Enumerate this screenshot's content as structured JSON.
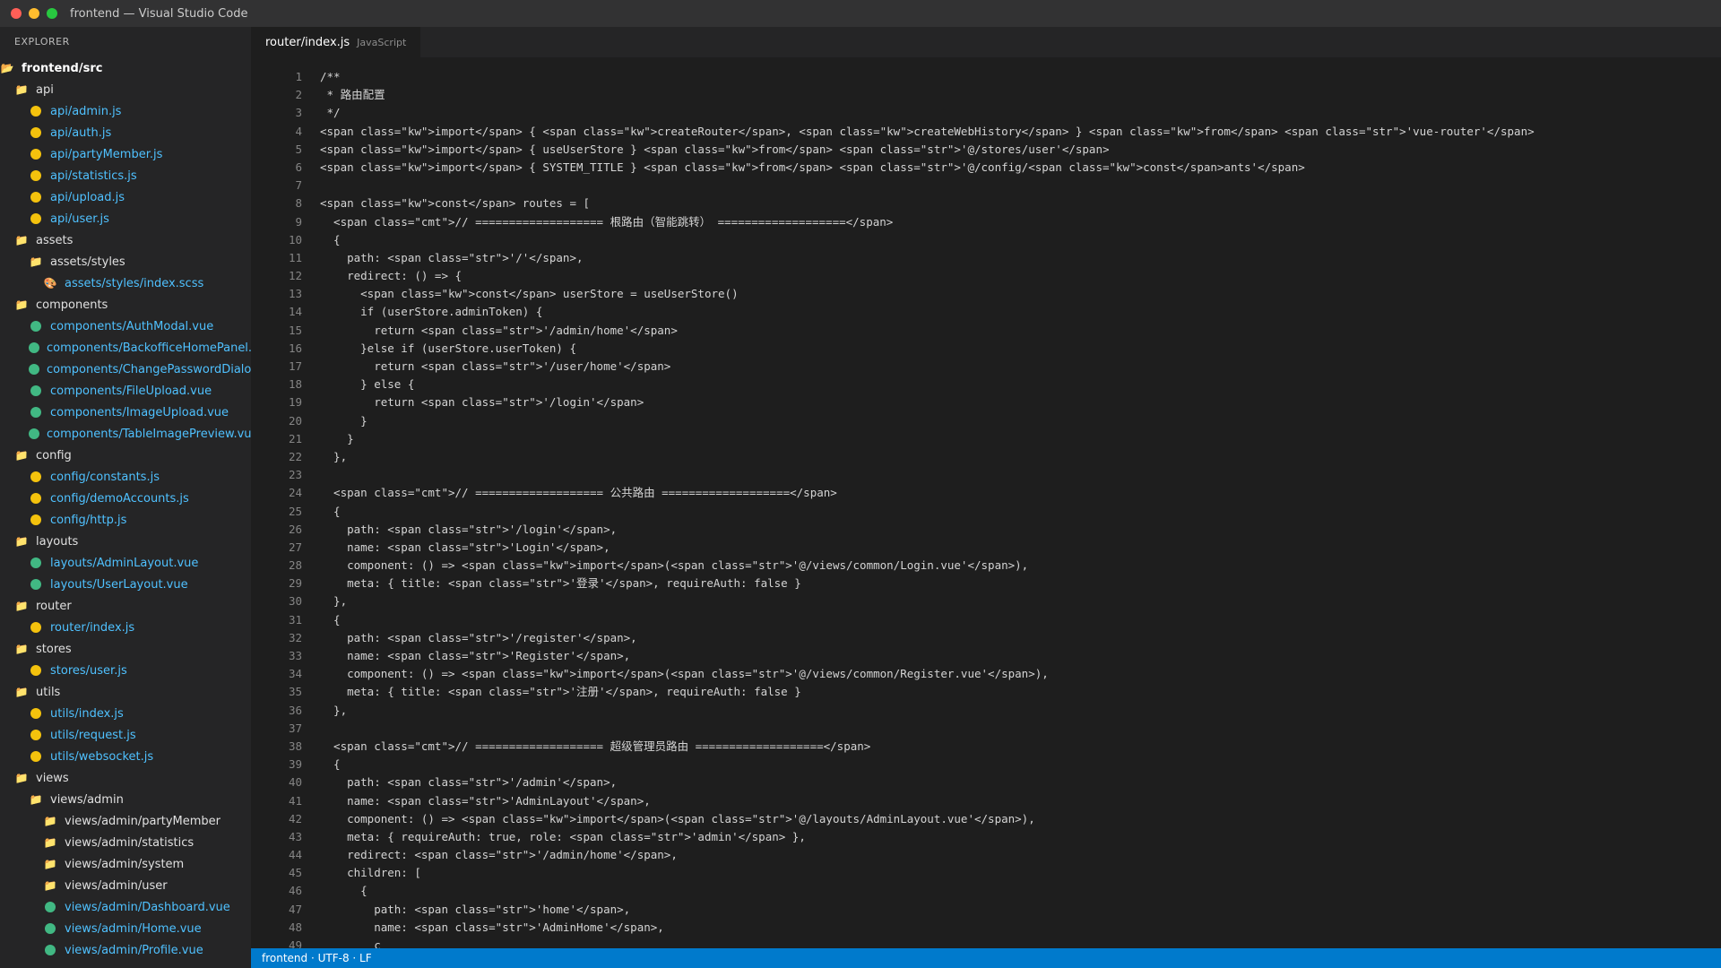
{
  "window": {
    "title": "frontend — Visual Studio Code"
  },
  "sidebar": {
    "header": "EXPLORER",
    "tree": [
      {
        "label": "frontend/src",
        "type": "root",
        "depth": 0
      },
      {
        "label": "api",
        "type": "folder",
        "depth": 1
      },
      {
        "label": "api/admin.js",
        "type": "js",
        "depth": 2
      },
      {
        "label": "api/auth.js",
        "type": "js",
        "depth": 2
      },
      {
        "label": "api/partyMember.js",
        "type": "js",
        "depth": 2
      },
      {
        "label": "api/statistics.js",
        "type": "js",
        "depth": 2
      },
      {
        "label": "api/upload.js",
        "type": "js",
        "depth": 2
      },
      {
        "label": "api/user.js",
        "type": "js",
        "depth": 2
      },
      {
        "label": "assets",
        "type": "folder",
        "depth": 1
      },
      {
        "label": "assets/styles",
        "type": "folder",
        "depth": 2
      },
      {
        "label": "assets/styles/index.scss",
        "type": "scss",
        "depth": 3
      },
      {
        "label": "components",
        "type": "folder",
        "depth": 1
      },
      {
        "label": "components/AuthModal.vue",
        "type": "vue",
        "depth": 2
      },
      {
        "label": "components/BackofficeHomePanel.v",
        "type": "vue",
        "depth": 2
      },
      {
        "label": "components/ChangePasswordDialog",
        "type": "vue",
        "depth": 2
      },
      {
        "label": "components/FileUpload.vue",
        "type": "vue",
        "depth": 2
      },
      {
        "label": "components/ImageUpload.vue",
        "type": "vue",
        "depth": 2
      },
      {
        "label": "components/TableImagePreview.vue",
        "type": "vue",
        "depth": 2
      },
      {
        "label": "config",
        "type": "folder",
        "depth": 1
      },
      {
        "label": "config/constants.js",
        "type": "js",
        "depth": 2
      },
      {
        "label": "config/demoAccounts.js",
        "type": "js",
        "depth": 2
      },
      {
        "label": "config/http.js",
        "type": "js",
        "depth": 2
      },
      {
        "label": "layouts",
        "type": "folder",
        "depth": 1
      },
      {
        "label": "layouts/AdminLayout.vue",
        "type": "vue",
        "depth": 2
      },
      {
        "label": "layouts/UserLayout.vue",
        "type": "vue",
        "depth": 2
      },
      {
        "label": "router",
        "type": "folder",
        "depth": 1
      },
      {
        "label": "router/index.js",
        "type": "js",
        "depth": 2
      },
      {
        "label": "stores",
        "type": "folder",
        "depth": 1
      },
      {
        "label": "stores/user.js",
        "type": "js",
        "depth": 2
      },
      {
        "label": "utils",
        "type": "folder",
        "depth": 1
      },
      {
        "label": "utils/index.js",
        "type": "js",
        "depth": 2
      },
      {
        "label": "utils/request.js",
        "type": "js",
        "depth": 2
      },
      {
        "label": "utils/websocket.js",
        "type": "js",
        "depth": 2
      },
      {
        "label": "views",
        "type": "folder",
        "depth": 1
      },
      {
        "label": "views/admin",
        "type": "folder",
        "depth": 2
      },
      {
        "label": "views/admin/partyMember",
        "type": "folder",
        "depth": 3
      },
      {
        "label": "views/admin/statistics",
        "type": "folder",
        "depth": 3
      },
      {
        "label": "views/admin/system",
        "type": "folder",
        "depth": 3
      },
      {
        "label": "views/admin/user",
        "type": "folder",
        "depth": 3
      },
      {
        "label": "views/admin/Dashboard.vue",
        "type": "vue",
        "depth": 3
      },
      {
        "label": "views/admin/Home.vue",
        "type": "vue",
        "depth": 3
      },
      {
        "label": "views/admin/Profile.vue",
        "type": "vue",
        "depth": 3
      }
    ]
  },
  "editor": {
    "tab": {
      "name": "router/index.js",
      "language": "JavaScript"
    },
    "lines": [
      "/**",
      " * 路由配置",
      " */",
      "<span class=\"kw\">import</span> { <span class=\"kw\">createRouter</span>, <span class=\"kw\">createWebHistory</span> } <span class=\"kw\">from</span> <span class=\"str\">'vue-router'</span>",
      "<span class=\"kw\">import</span> { useUserStore } <span class=\"kw\">from</span> <span class=\"str\">'@/stores/user'</span>",
      "<span class=\"kw\">import</span> { SYSTEM_TITLE } <span class=\"kw\">from</span> <span class=\"str\">'@/config/<span class=\"kw\">const</span>ants'</span>",
      "",
      "<span class=\"kw\">const</span> routes = [",
      "  <span class=\"cmt\">// =================== 根路由（智能跳转） ===================</span>",
      "  {",
      "    path: <span class=\"str\">'/'</span>,",
      "    redirect: () => {",
      "      <span class=\"kw\">const</span> userStore = useUserStore()",
      "      if (userStore.adminToken) {",
      "        return <span class=\"str\">'/admin/home'</span>",
      "      }else if (userStore.userToken) {",
      "        return <span class=\"str\">'/user/home'</span>",
      "      } else {",
      "        return <span class=\"str\">'/login'</span>",
      "      }",
      "    }",
      "  },",
      "",
      "  <span class=\"cmt\">// =================== 公共路由 ===================</span>",
      "  {",
      "    path: <span class=\"str\">'/login'</span>,",
      "    name: <span class=\"str\">'Login'</span>,",
      "    component: () => <span class=\"kw\">import</span>(<span class=\"str\">'@/views/common/Login.vue'</span>),",
      "    meta: { title: <span class=\"str\">'登录'</span>, requireAuth: false }",
      "  },",
      "  {",
      "    path: <span class=\"str\">'/register'</span>,",
      "    name: <span class=\"str\">'Register'</span>,",
      "    component: () => <span class=\"kw\">import</span>(<span class=\"str\">'@/views/common/Register.vue'</span>),",
      "    meta: { title: <span class=\"str\">'注册'</span>, requireAuth: false }",
      "  },",
      "",
      "  <span class=\"cmt\">// =================== 超级管理员路由 ===================</span>",
      "  {",
      "    path: <span class=\"str\">'/admin'</span>,",
      "    name: <span class=\"str\">'AdminLayout'</span>,",
      "    component: () => <span class=\"kw\">import</span>(<span class=\"str\">'@/layouts/AdminLayout.vue'</span>),",
      "    meta: { requireAuth: true, role: <span class=\"str\">'admin'</span> },",
      "    redirect: <span class=\"str\">'/admin/home'</span>,",
      "    children: [",
      "      {",
      "        path: <span class=\"str\">'home'</span>,",
      "        name: <span class=\"str\">'AdminHome'</span>,",
      "        c"
    ]
  },
  "statusbar": {
    "text": "frontend · UTF-8 · LF"
  }
}
